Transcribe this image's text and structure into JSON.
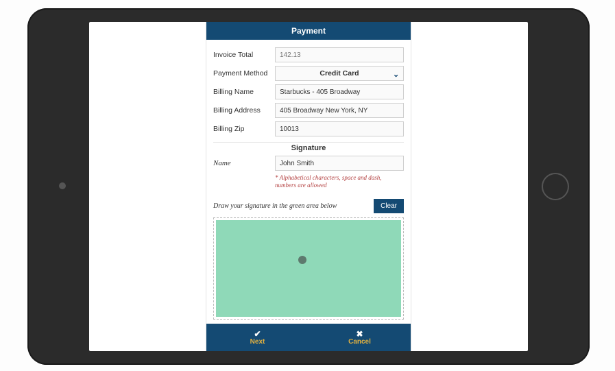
{
  "header": {
    "title": "Payment"
  },
  "form": {
    "invoice_total": {
      "label": "Invoice Total",
      "placeholder": "142.13",
      "value": ""
    },
    "payment_method": {
      "label": "Payment Method",
      "selected": "Credit Card"
    },
    "billing_name": {
      "label": "Billing Name",
      "value": "Starbucks - 405 Broadway"
    },
    "billing_address": {
      "label": "Billing Address",
      "value": "405 Broadway New York, NY"
    },
    "billing_zip": {
      "label": "Billing Zip",
      "value": "10013"
    }
  },
  "signature": {
    "section_title": "Signature",
    "name_label": "Name",
    "name_value": "John Smith",
    "hint": "* Alphabetical characters, space and dash, numbers are allowed",
    "instruction": "Draw your signature in the green area below",
    "clear_label": "Clear"
  },
  "footer": {
    "next_label": "Next",
    "cancel_label": "Cancel"
  },
  "icons": {
    "chevron": "⌄",
    "check": "✔",
    "close": "✖"
  },
  "colors": {
    "brand": "#144a73",
    "accent": "#e0b040",
    "signature_pad": "#8fd9b8"
  }
}
